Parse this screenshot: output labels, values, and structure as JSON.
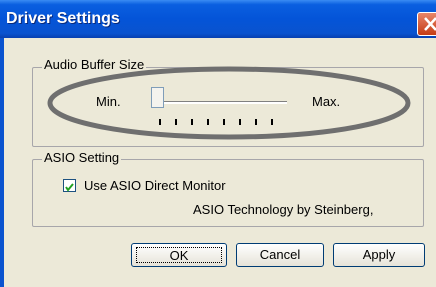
{
  "window": {
    "title": "Driver Settings"
  },
  "buffer": {
    "group_label": "Audio Buffer Size",
    "min_label": "Min.",
    "max_label": "Max.",
    "level": 0
  },
  "asio": {
    "group_label": "ASIO Setting",
    "checkbox_label": "Use ASIO Direct Monitor",
    "checked": true,
    "credit": "ASIO Technology by Steinberg,"
  },
  "buttons": {
    "ok": "OK",
    "cancel": "Cancel",
    "apply": "Apply"
  },
  "colors": {
    "title_bar": "#0454d8",
    "highlight_ellipse": "#6f6f6f"
  }
}
